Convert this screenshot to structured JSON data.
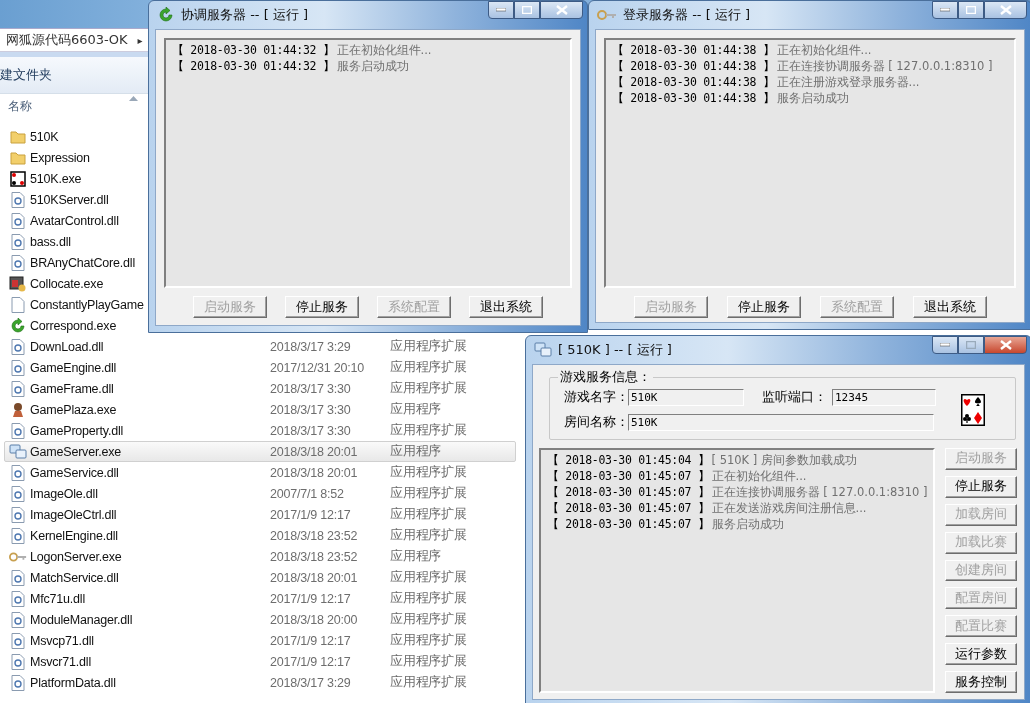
{
  "explorer": {
    "breadcrumb": "网狐源代码6603-OK",
    "breadcrumb_arrow": "▸",
    "toolbar_label": "建文件夹",
    "column_header": "名称",
    "files": [
      {
        "name": "510K",
        "kind": "folder",
        "selected": false
      },
      {
        "name": "Expression",
        "kind": "folder",
        "selected": false
      },
      {
        "name": "510K.exe",
        "kind": "cards",
        "selected": false
      },
      {
        "name": "510KServer.dll",
        "kind": "dll",
        "selected": false
      },
      {
        "name": "AvatarControl.dll",
        "kind": "dll",
        "selected": false
      },
      {
        "name": "bass.dll",
        "kind": "dll",
        "selected": false
      },
      {
        "name": "BRAnyChatCore.dll",
        "kind": "dll",
        "selected": false
      },
      {
        "name": "Collocate.exe",
        "kind": "app",
        "selected": false
      },
      {
        "name": "ConstantlyPlayGame",
        "kind": "file",
        "selected": false
      },
      {
        "name": "Correspond.exe",
        "kind": "arrows",
        "selected": false
      },
      {
        "name": "DownLoad.dll",
        "kind": "dll",
        "date": "2018/3/17 3:29",
        "type": "应用程序扩展",
        "selected": false
      },
      {
        "name": "GameEngine.dll",
        "kind": "dll",
        "date": "2017/12/31 20:10",
        "type": "应用程序扩展",
        "selected": false
      },
      {
        "name": "GameFrame.dll",
        "kind": "dll",
        "date": "2018/3/17 3:30",
        "type": "应用程序扩展",
        "selected": false
      },
      {
        "name": "GamePlaza.exe",
        "kind": "figure",
        "date": "2018/3/17 3:30",
        "type": "应用程序",
        "selected": false
      },
      {
        "name": "GameProperty.dll",
        "kind": "dll",
        "date": "2018/3/17 3:30",
        "type": "应用程序扩展",
        "selected": false
      },
      {
        "name": "GameServer.exe",
        "kind": "computers",
        "date": "2018/3/18 20:01",
        "type": "应用程序",
        "selected": true
      },
      {
        "name": "GameService.dll",
        "kind": "dll",
        "date": "2018/3/18 20:01",
        "type": "应用程序扩展",
        "selected": false
      },
      {
        "name": "ImageOle.dll",
        "kind": "dll",
        "date": "2007/7/1 8:52",
        "type": "应用程序扩展",
        "selected": false
      },
      {
        "name": "ImageOleCtrl.dll",
        "kind": "dll",
        "date": "2017/1/9 12:17",
        "type": "应用程序扩展",
        "selected": false
      },
      {
        "name": "KernelEngine.dll",
        "kind": "dll",
        "date": "2018/3/18 23:52",
        "type": "应用程序扩展",
        "selected": false
      },
      {
        "name": "LogonServer.exe",
        "kind": "key",
        "date": "2018/3/18 23:52",
        "type": "应用程序",
        "selected": false
      },
      {
        "name": "MatchService.dll",
        "kind": "dll",
        "date": "2018/3/18 20:01",
        "type": "应用程序扩展",
        "selected": false
      },
      {
        "name": "Mfc71u.dll",
        "kind": "dll",
        "date": "2017/1/9 12:17",
        "type": "应用程序扩展",
        "selected": false
      },
      {
        "name": "ModuleManager.dll",
        "kind": "dll",
        "date": "2018/3/18 20:00",
        "type": "应用程序扩展",
        "selected": false
      },
      {
        "name": "Msvcp71.dll",
        "kind": "dll",
        "date": "2017/1/9 12:17",
        "type": "应用程序扩展",
        "selected": false
      },
      {
        "name": "Msvcr71.dll",
        "kind": "dll",
        "date": "2017/1/9 12:17",
        "type": "应用程序扩展",
        "selected": false
      },
      {
        "name": "PlatformData.dll",
        "kind": "dll",
        "date": "2018/3/17 3:29",
        "type": "应用程序扩展",
        "selected": false
      }
    ]
  },
  "windows": [
    {
      "kind": "console",
      "title": "协调服务器 -- [ 运行 ]",
      "log": [
        {
          "time": "【 2018-03-30 01:44:32 】",
          "message": "正在初始化组件..."
        },
        {
          "time": "【 2018-03-30 01:44:32 】",
          "message": "服务启动成功"
        }
      ],
      "buttons": [
        {
          "label": "启动服务",
          "disabled": true
        },
        {
          "label": "停止服务",
          "disabled": false
        },
        {
          "label": "系统配置",
          "disabled": true
        },
        {
          "label": "退出系统",
          "disabled": false
        }
      ]
    },
    {
      "kind": "console",
      "title": "登录服务器 -- [ 运行 ]",
      "log": [
        {
          "time": "【 2018-03-30 01:44:38 】",
          "message": "正在初始化组件..."
        },
        {
          "time": "【 2018-03-30 01:44:38 】",
          "message": "正在连接协调服务器 [ 127.0.0.1:8310 ]"
        },
        {
          "time": "【 2018-03-30 01:44:38 】",
          "message": "正在注册游戏登录服务器..."
        },
        {
          "time": "【 2018-03-30 01:44:38 】",
          "message": "服务启动成功"
        }
      ],
      "buttons": [
        {
          "label": "启动服务",
          "disabled": true
        },
        {
          "label": "停止服务",
          "disabled": false
        },
        {
          "label": "系统配置",
          "disabled": true
        },
        {
          "label": "退出系统",
          "disabled": false
        }
      ]
    },
    {
      "kind": "game",
      "title": "[ 510K ] -- [ 运行 ]",
      "info": {
        "title": "游戏服务信息：",
        "game_name_label": "游戏名字：",
        "game_name": "510K",
        "port_label": "监听端口：",
        "port": "12345",
        "room_name_label": "房间名称：",
        "room_name": "510K"
      },
      "log": [
        {
          "time": "【 2018-03-30 01:45:04 】",
          "message": "[ 510K ] 房间参数加载成功"
        },
        {
          "time": "【 2018-03-30 01:45:07 】",
          "message": "正在初始化组件..."
        },
        {
          "time": "【 2018-03-30 01:45:07 】",
          "message": "正在连接协调服务器 [ 127.0.0.1:8310 ]"
        },
        {
          "time": "【 2018-03-30 01:45:07 】",
          "message": "正在发送游戏房间注册信息..."
        },
        {
          "time": "【 2018-03-30 01:45:07 】",
          "message": "服务启动成功"
        }
      ],
      "buttons": [
        {
          "label": "启动服务",
          "disabled": true
        },
        {
          "label": "停止服务",
          "disabled": false
        },
        {
          "label": "加载房间",
          "disabled": true
        },
        {
          "label": "加载比赛",
          "disabled": true
        },
        {
          "label": "创建房间",
          "disabled": true
        },
        {
          "label": "配置房间",
          "disabled": true
        },
        {
          "label": "配置比赛",
          "disabled": true
        },
        {
          "label": "运行参数",
          "disabled": false
        },
        {
          "label": "服务控制",
          "disabled": false
        }
      ]
    }
  ]
}
